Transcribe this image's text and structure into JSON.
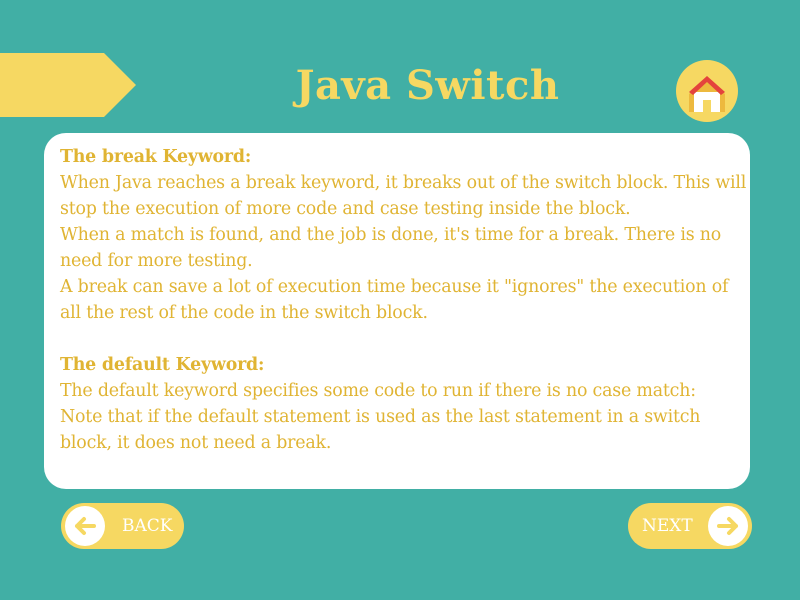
{
  "page": {
    "title": "Java Switch"
  },
  "colors": {
    "background": "#41afa5",
    "accent_yellow": "#f6d862",
    "text_gold": "#e0b433",
    "roof_red": "#e4433c",
    "card": "#ffffff"
  },
  "header": {
    "ribbon_icon": "banner-ribbon",
    "home_icon": "home-icon"
  },
  "content": {
    "break_heading": "The break Keyword:",
    "break_p1": "When Java reaches a break keyword, it breaks out of the switch block. This will stop the execution of more code and case testing inside the block.",
    "break_p2": "When a match is found, and the job is done, it's time for a break. There is no need for more testing.",
    "break_p3": "A break can save a lot of execution time because it \"ignores\" the execution of all the rest of the code in the switch block.",
    "default_heading": "The default Keyword:",
    "default_p1": "The default keyword specifies some code to run if there is no case match:",
    "default_p2": "Note that if the default statement is used as the last statement in a switch block, it does not need a break."
  },
  "nav": {
    "back_label": "BACK",
    "back_icon": "arrow-left-icon",
    "next_label": "NEXT",
    "next_icon": "arrow-right-icon"
  }
}
